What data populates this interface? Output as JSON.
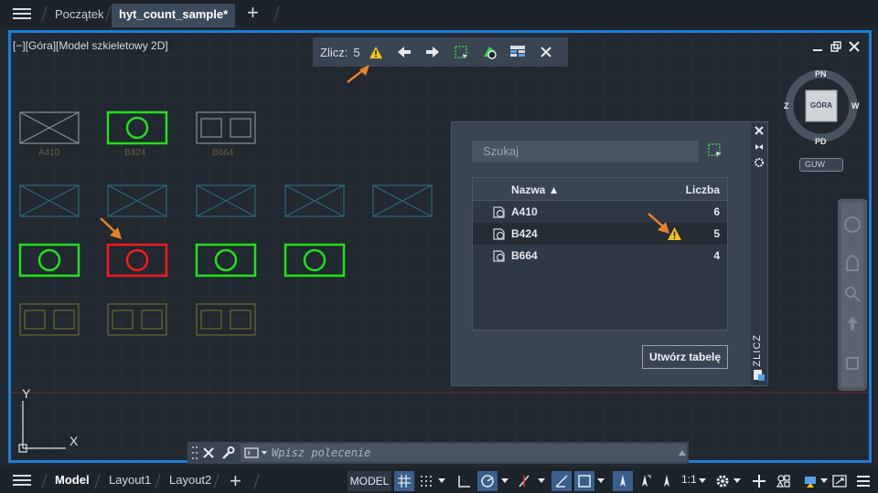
{
  "tabs": {
    "home": "Początek",
    "doc": "hyt_count_sample*",
    "add": "+"
  },
  "viewport": {
    "label": "[−][Góra][Model szkieletowy 2D]",
    "blocks": [
      {
        "label": "A410"
      },
      {
        "label": "B424"
      },
      {
        "label": "B664"
      }
    ],
    "axis_y": "Y",
    "axis_x": "X"
  },
  "count_toolbar": {
    "label": "Zlicz:",
    "value": "5"
  },
  "viewcube": {
    "north": "PN",
    "south": "PD",
    "west": "Z",
    "east": "W",
    "face": "GÓRA",
    "ucs": "GUW"
  },
  "count_panel": {
    "search_placeholder": "Szukaj",
    "col_name": "Nazwa ▲",
    "col_count": "Liczba",
    "rows": [
      {
        "name": "A410",
        "count": "6"
      },
      {
        "name": "B424",
        "count": "5"
      },
      {
        "name": "B664",
        "count": "4"
      }
    ],
    "create_table": "Utwórz tabelę",
    "side_title": "ZLICZ"
  },
  "command_line": {
    "placeholder": "Wpisz polecenie"
  },
  "status": {
    "tabs": [
      "Model",
      "Layout1",
      "Layout2"
    ],
    "model_button": "MODEL",
    "scale": "1:1"
  },
  "colors": {
    "accent": "#1b7ed6",
    "green": "#22e01a",
    "red": "#ff1a1a",
    "warning": "#f5c518",
    "arrow": "#e8822a"
  }
}
